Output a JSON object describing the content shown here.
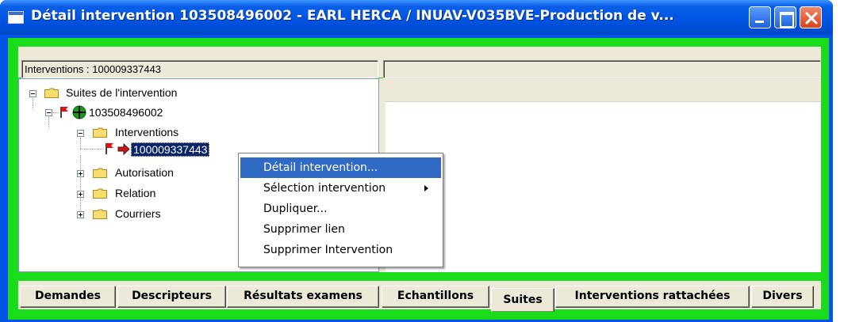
{
  "window": {
    "title": "Détail intervention 103508496002 - EARL HERCA / INUAV-V035BVE-Production de v...",
    "controls": {
      "minimize": "minimize",
      "maximize": "maximize",
      "close": "close"
    }
  },
  "header": {
    "left_field": "Interventions : 100009337443",
    "right_field": ""
  },
  "tree": {
    "root": "Suites de l'intervention",
    "intervention": "103508496002",
    "interventions_folder": "Interventions",
    "selected_item": "100009337443",
    "folders": [
      "Autorisation",
      "Relation",
      "Courriers"
    ]
  },
  "context_menu": {
    "items": [
      {
        "label": "Détail intervention...",
        "highlighted": true
      },
      {
        "label": "Sélection intervention",
        "submenu": true
      },
      {
        "label": "Dupliquer..."
      },
      {
        "label": "Supprimer lien"
      },
      {
        "label": "Supprimer Intervention"
      }
    ]
  },
  "tabs": [
    {
      "label": "Demandes"
    },
    {
      "label": "Descripteurs"
    },
    {
      "label": "Résultats examens"
    },
    {
      "label": "Echantillons"
    },
    {
      "label": "Suites",
      "active": true
    },
    {
      "label": "Interventions rattachées"
    },
    {
      "label": "Divers"
    }
  ],
  "colors": {
    "titlebar": "#0054e3",
    "client_border": "#1bdc1b",
    "selection": "#0a246a",
    "menu_highlight": "#316ac5"
  }
}
